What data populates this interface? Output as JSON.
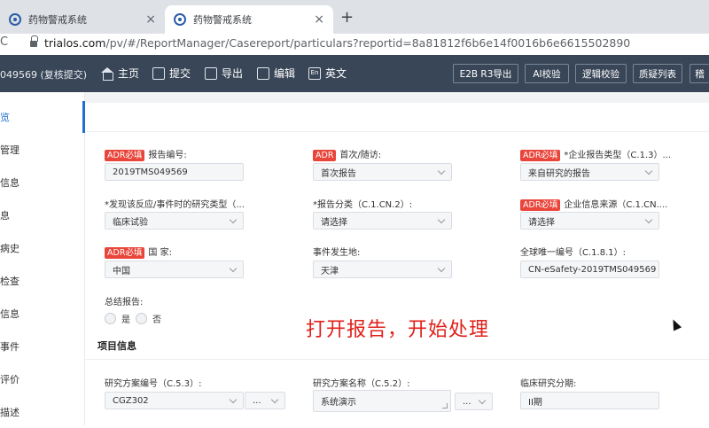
{
  "browser": {
    "tabs": [
      {
        "title": "药物警戒系统",
        "active": false
      },
      {
        "title": "药物警戒系统",
        "active": true
      }
    ],
    "new_tab": "+",
    "close_glyph": "×",
    "url_host": "trialos.com",
    "url_path": "/pv/#/ReportManager/Casereport/particulars?reportid=8a81812f6b6e14f0016b6e6615502890"
  },
  "toolbar": {
    "case_id": "049569 (复核提交)",
    "buttons": [
      "主页",
      "提交",
      "导出",
      "编辑",
      "英文"
    ],
    "en_icon_text": "En",
    "right_buttons": [
      "E2B R3导出",
      "AI校验",
      "逻辑校验",
      "质疑列表",
      "稽"
    ]
  },
  "sidebar": {
    "items": [
      "览",
      "管理",
      "信息",
      "息",
      "病史",
      "检查",
      "信息",
      "事件",
      "评价",
      "描述"
    ]
  },
  "form": {
    "required_badge": "ADR必填",
    "report_number_label": "报告编号:",
    "report_number_value": "2019TMS049569",
    "first_followup_label": "首次/随访:",
    "first_followup_value": "首次报告",
    "enterprise_report_type_label": "*企业报告类型（C.1.3）...",
    "enterprise_report_type_value": "来自研究的报告",
    "study_type_label": "*发现该反应/事件时的研究类型（...",
    "study_type_value": "临床试验",
    "report_class_label": "*报告分类（C.1.CN.2）:",
    "report_class_value": "请选择",
    "enterprise_source_label": "企业信息来源（C.1.CN....",
    "enterprise_source_value": "请选择",
    "country_label": "国 家:",
    "country_value": "中国",
    "event_place_label": "事件发生地:",
    "event_place_value": "天津",
    "global_id_label": "全球唯一编号（C.1.8.1）:",
    "global_id_value": "CN-eSafety-2019TMS049569",
    "summary_label": "总结报告:",
    "summary_options": [
      "是",
      "否"
    ]
  },
  "overlay_text": "打开报告，开始处理",
  "project": {
    "title": "项目信息",
    "protocol_no_label": "研究方案编号（C.5.3）:",
    "protocol_no_value": "CGZ302",
    "protocol_no_extra": "...",
    "protocol_name_label": "研究方案名称（C.5.2）:",
    "protocol_name_value": "系统演示",
    "protocol_name_extra": "...",
    "phase_label": "临床研究分期:",
    "phase_value": "II期"
  },
  "colors": {
    "toolbar_bg": "#394657",
    "required_badge": "#e9453a",
    "overlay_text": "#e0201a",
    "active_nav": "#1f6fd1"
  }
}
